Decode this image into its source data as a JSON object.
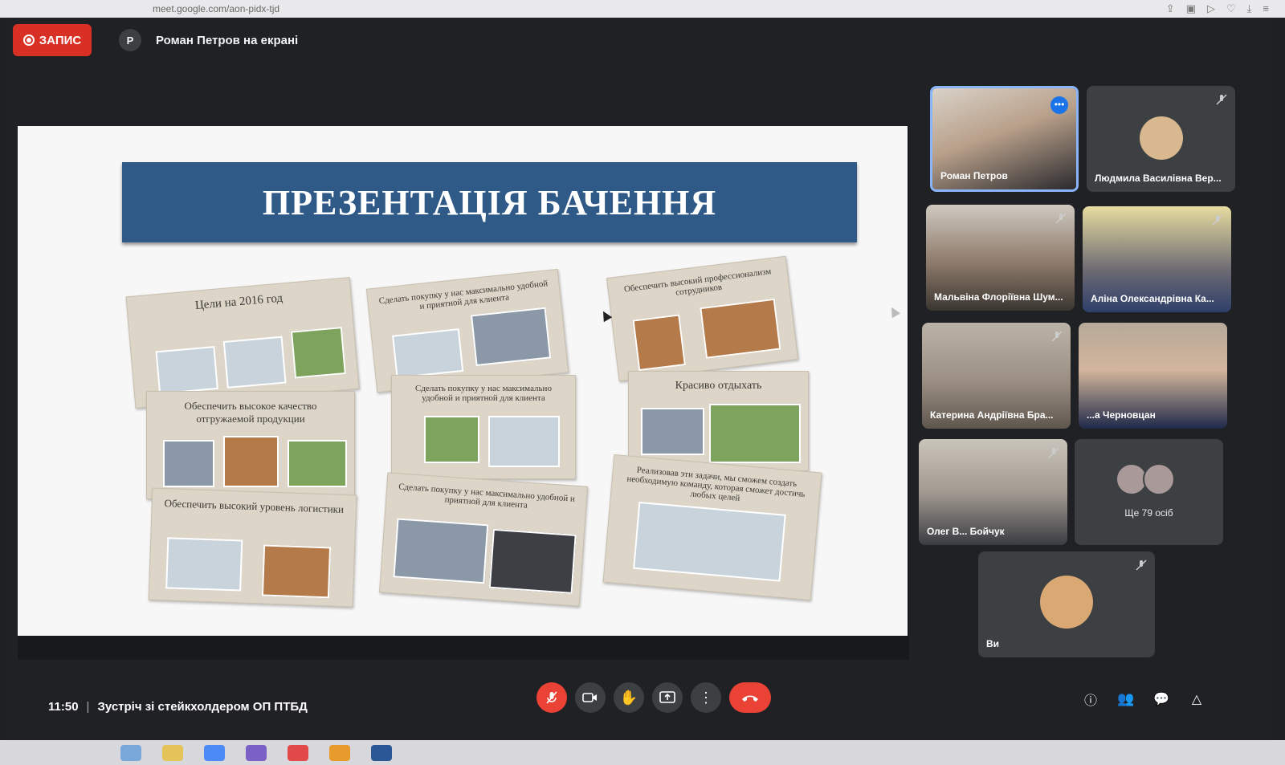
{
  "browser": {
    "url": "meet.google.com/aon-pidx-tjd"
  },
  "topbar": {
    "record_label": "ЗАПИС",
    "presenter_initial": "Р",
    "presenter_text": "Роман Петров на екрані"
  },
  "slide": {
    "title": "ПРЕЗЕНТАЦІЯ БАЧЕННЯ",
    "cards": [
      "Цели на 2016 год",
      "Обеспечить высокое качество отгружаемой продукции",
      "Обеспечить высокий уровень логистики",
      "Сделать покупку у нас максимально удобной и приятной для клиента",
      "Сделать покупку у нас максимально удобной и приятной для клиента",
      "Сделать покупку у нас максимально удобной и приятной для клиента",
      "Обеспечить высокий профессионализм сотрудников",
      "Красиво отдыхать",
      "Реализовав эти задачи, мы сможем создать необходимую команду, которая сможет достичь любых целей"
    ]
  },
  "participants": [
    {
      "name": "Роман Петров",
      "active": true
    },
    {
      "name": "Людмила Василівна Вер..."
    },
    {
      "name": "Мальвіна Флоріївна Шум..."
    },
    {
      "name": "Аліна Олександрівна Ка..."
    },
    {
      "name": "Катерина Андріївна Бра..."
    },
    {
      "name": "...а Черновцан"
    },
    {
      "name": "Олег В... Бойчук"
    },
    {
      "name": "Ще 79 осіб"
    },
    {
      "name": "Ви"
    }
  ],
  "bottombar": {
    "time": "11:50",
    "separator": "|",
    "meeting_title": "Зустріч зі стейкхолдером ОП ПТБД"
  },
  "colors": {
    "record_red": "#d93025",
    "banner_blue": "#2f5a88",
    "active_blue": "#8ab4f8",
    "end_call_red": "#ea4335"
  }
}
